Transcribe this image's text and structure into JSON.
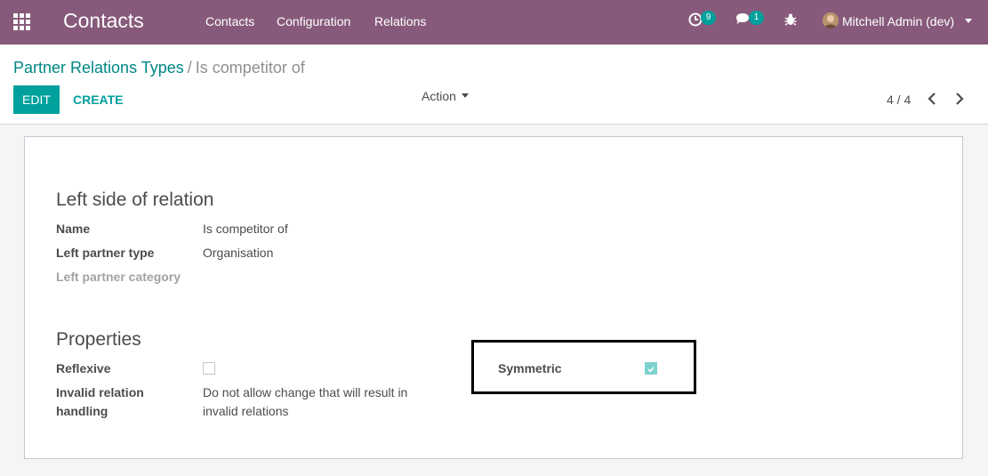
{
  "navbar": {
    "app_title": "Contacts",
    "menu": [
      "Contacts",
      "Configuration",
      "Relations"
    ],
    "activity_badge": "9",
    "messages_badge": "1",
    "user_name": "Mitchell Admin (dev)",
    "color": "#875a7b"
  },
  "control_panel": {
    "breadcrumb_parent": "Partner Relations Types",
    "breadcrumb_separator": "/",
    "breadcrumb_current": "Is competitor of",
    "edit_label": "EDIT",
    "create_label": "CREATE",
    "action_label": "Action",
    "pager": "4 / 4"
  },
  "form": {
    "left_side": {
      "title": "Left side of relation",
      "name_label": "Name",
      "name_value": "Is competitor of",
      "partner_type_label": "Left partner type",
      "partner_type_value": "Organisation",
      "partner_category_label": "Left partner category",
      "partner_category_value": ""
    },
    "properties": {
      "title": "Properties",
      "reflexive_label": "Reflexive",
      "reflexive_checked": false,
      "invalid_label_line1": "Invalid relation",
      "invalid_label_line2": "handling",
      "invalid_value_line1": "Do not allow change that will result in",
      "invalid_value_line2": "invalid relations",
      "symmetric_label": "Symmetric",
      "symmetric_checked": true
    }
  },
  "colors": {
    "primary": "#00a09d",
    "link": "#008784",
    "checked": "#7dd2ce"
  }
}
